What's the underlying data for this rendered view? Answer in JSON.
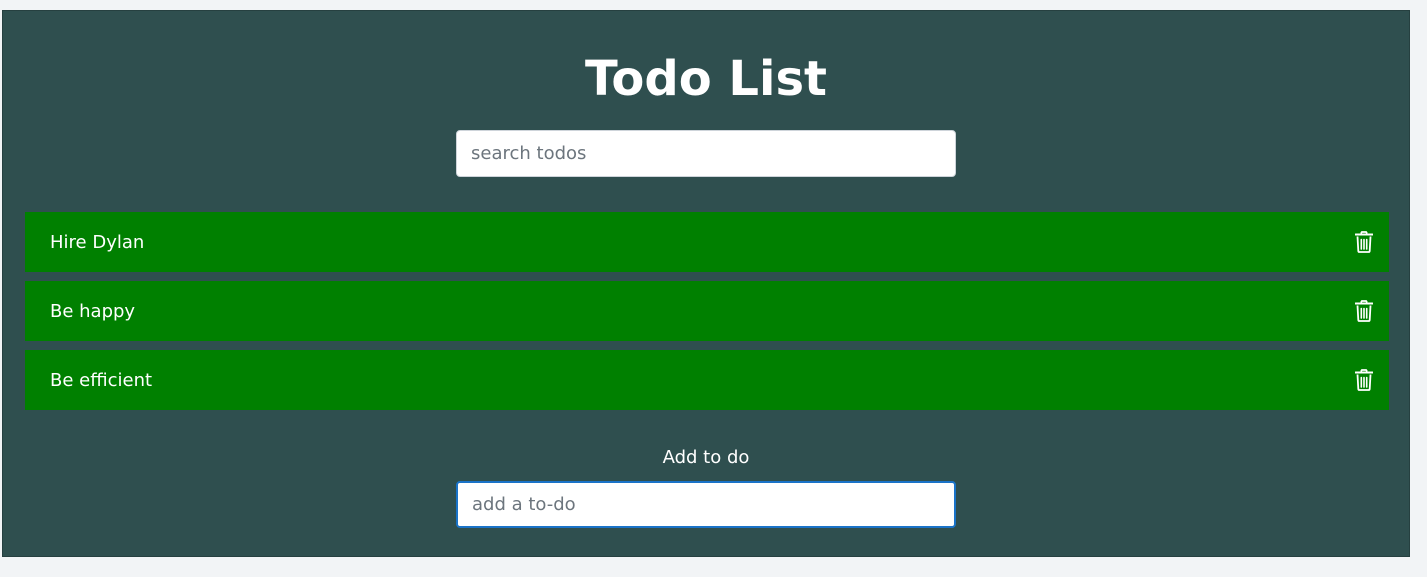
{
  "app": {
    "title": "Todo List"
  },
  "search": {
    "placeholder": "search todos",
    "value": ""
  },
  "todos": [
    {
      "text": "Hire Dylan",
      "icon": "trash-icon"
    },
    {
      "text": "Be happy",
      "icon": "trash-icon"
    },
    {
      "text": "Be efficient",
      "icon": "trash-icon"
    }
  ],
  "add_form": {
    "label": "Add to do",
    "placeholder": "add a to-do",
    "value": ""
  },
  "colors": {
    "panel_bg": "#2f4f4f",
    "todo_bg": "#008000",
    "text": "#ffffff",
    "focus_border": "#1a73c8"
  }
}
